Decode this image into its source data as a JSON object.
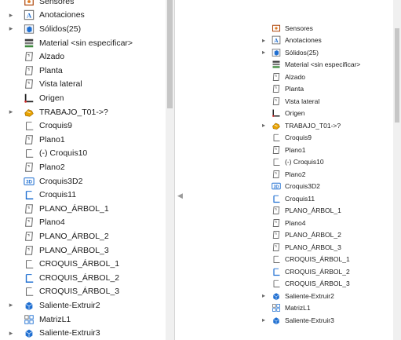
{
  "left_tree": {
    "items": [
      {
        "label": "Sensores",
        "icon": "sensors-icon",
        "expandable": false
      },
      {
        "label": "Anotaciones",
        "icon": "annotations-icon",
        "expandable": true
      },
      {
        "label": "Sólidos(25)",
        "icon": "solid-bodies-icon",
        "expandable": true
      },
      {
        "label": "Material <sin especificar>",
        "icon": "material-icon",
        "expandable": false
      },
      {
        "label": "Alzado",
        "icon": "plane-icon",
        "expandable": false
      },
      {
        "label": "Planta",
        "icon": "plane-icon",
        "expandable": false
      },
      {
        "label": "Vista lateral",
        "icon": "plane-icon",
        "expandable": false
      },
      {
        "label": "Origen",
        "icon": "origin-icon",
        "expandable": false
      },
      {
        "label": "TRABAJO_T01->?",
        "icon": "part-folder-icon",
        "expandable": true
      },
      {
        "label": "Croquis9",
        "icon": "sketch-icon",
        "expandable": false
      },
      {
        "label": "Plano1",
        "icon": "plane-icon",
        "expandable": false
      },
      {
        "label": "(-) Croquis10",
        "icon": "sketch-icon",
        "expandable": false
      },
      {
        "label": "Plano2",
        "icon": "plane-icon",
        "expandable": false
      },
      {
        "label": "Croquis3D2",
        "icon": "sketch-3d-icon",
        "expandable": false
      },
      {
        "label": "Croquis11",
        "icon": "sketch-selected-icon",
        "expandable": false
      },
      {
        "label": "PLANO_ÁRBOL_1",
        "icon": "plane-icon",
        "expandable": false
      },
      {
        "label": "Plano4",
        "icon": "plane-icon",
        "expandable": false
      },
      {
        "label": "PLANO_ÁRBOL_2",
        "icon": "plane-icon",
        "expandable": false
      },
      {
        "label": "PLANO_ÁRBOL_3",
        "icon": "plane-icon",
        "expandable": false
      },
      {
        "label": "CROQUIS_ÁRBOL_1",
        "icon": "sketch-icon",
        "expandable": false
      },
      {
        "label": "CROQUIS_ÁRBOL_2",
        "icon": "sketch-selected-icon",
        "expandable": false
      },
      {
        "label": "CROQUIS_ÁRBOL_3",
        "icon": "sketch-icon",
        "expandable": false
      },
      {
        "label": "Saliente-Extruir2",
        "icon": "extrude-icon",
        "expandable": true
      },
      {
        "label": "MatrizL1",
        "icon": "linear-pattern-icon",
        "expandable": false
      },
      {
        "label": "Saliente-Extruir3",
        "icon": "extrude-icon",
        "expandable": true
      }
    ]
  },
  "right_tree": {
    "items": [
      {
        "label": "Sensores",
        "icon": "sensors-icon",
        "expandable": false
      },
      {
        "label": "Anotaciones",
        "icon": "annotations-icon",
        "expandable": true
      },
      {
        "label": "Sólidos(25)",
        "icon": "solid-bodies-icon",
        "expandable": true
      },
      {
        "label": "Material <sin especificar>",
        "icon": "material-icon",
        "expandable": false
      },
      {
        "label": "Alzado",
        "icon": "plane-icon",
        "expandable": false
      },
      {
        "label": "Planta",
        "icon": "plane-icon",
        "expandable": false
      },
      {
        "label": "Vista lateral",
        "icon": "plane-icon",
        "expandable": false
      },
      {
        "label": "Origen",
        "icon": "origin-icon",
        "expandable": false
      },
      {
        "label": "TRABAJO_T01->?",
        "icon": "part-folder-icon",
        "expandable": true
      },
      {
        "label": "Croquis9",
        "icon": "sketch-icon",
        "expandable": false
      },
      {
        "label": "Plano1",
        "icon": "plane-icon",
        "expandable": false
      },
      {
        "label": "(-) Croquis10",
        "icon": "sketch-icon",
        "expandable": false
      },
      {
        "label": "Plano2",
        "icon": "plane-icon",
        "expandable": false
      },
      {
        "label": "Croquis3D2",
        "icon": "sketch-3d-icon",
        "expandable": false
      },
      {
        "label": "Croquis11",
        "icon": "sketch-selected-icon",
        "expandable": false
      },
      {
        "label": "PLANO_ÁRBOL_1",
        "icon": "plane-icon",
        "expandable": false
      },
      {
        "label": "Plano4",
        "icon": "plane-icon",
        "expandable": false
      },
      {
        "label": "PLANO_ÁRBOL_2",
        "icon": "plane-icon",
        "expandable": false
      },
      {
        "label": "PLANO_ÁRBOL_3",
        "icon": "plane-icon",
        "expandable": false
      },
      {
        "label": "CROQUIS_ÁRBOL_1",
        "icon": "sketch-icon",
        "expandable": false
      },
      {
        "label": "CROQUIS_ÁRBOL_2",
        "icon": "sketch-selected-icon",
        "expandable": false
      },
      {
        "label": "CROQUIS_ÁRBOL_3",
        "icon": "sketch-icon",
        "expandable": false
      },
      {
        "label": "Saliente-Extruir2",
        "icon": "extrude-icon",
        "expandable": true
      },
      {
        "label": "MatrizL1",
        "icon": "linear-pattern-icon",
        "expandable": false
      },
      {
        "label": "Saliente-Extruir3",
        "icon": "extrude-icon",
        "expandable": true
      }
    ]
  },
  "colors": {
    "accent_blue": "#1f6fd1",
    "folder_yellow": "#e9a300",
    "origin_red": "#d22b2b",
    "icon_gray": "#6a6a6a"
  }
}
